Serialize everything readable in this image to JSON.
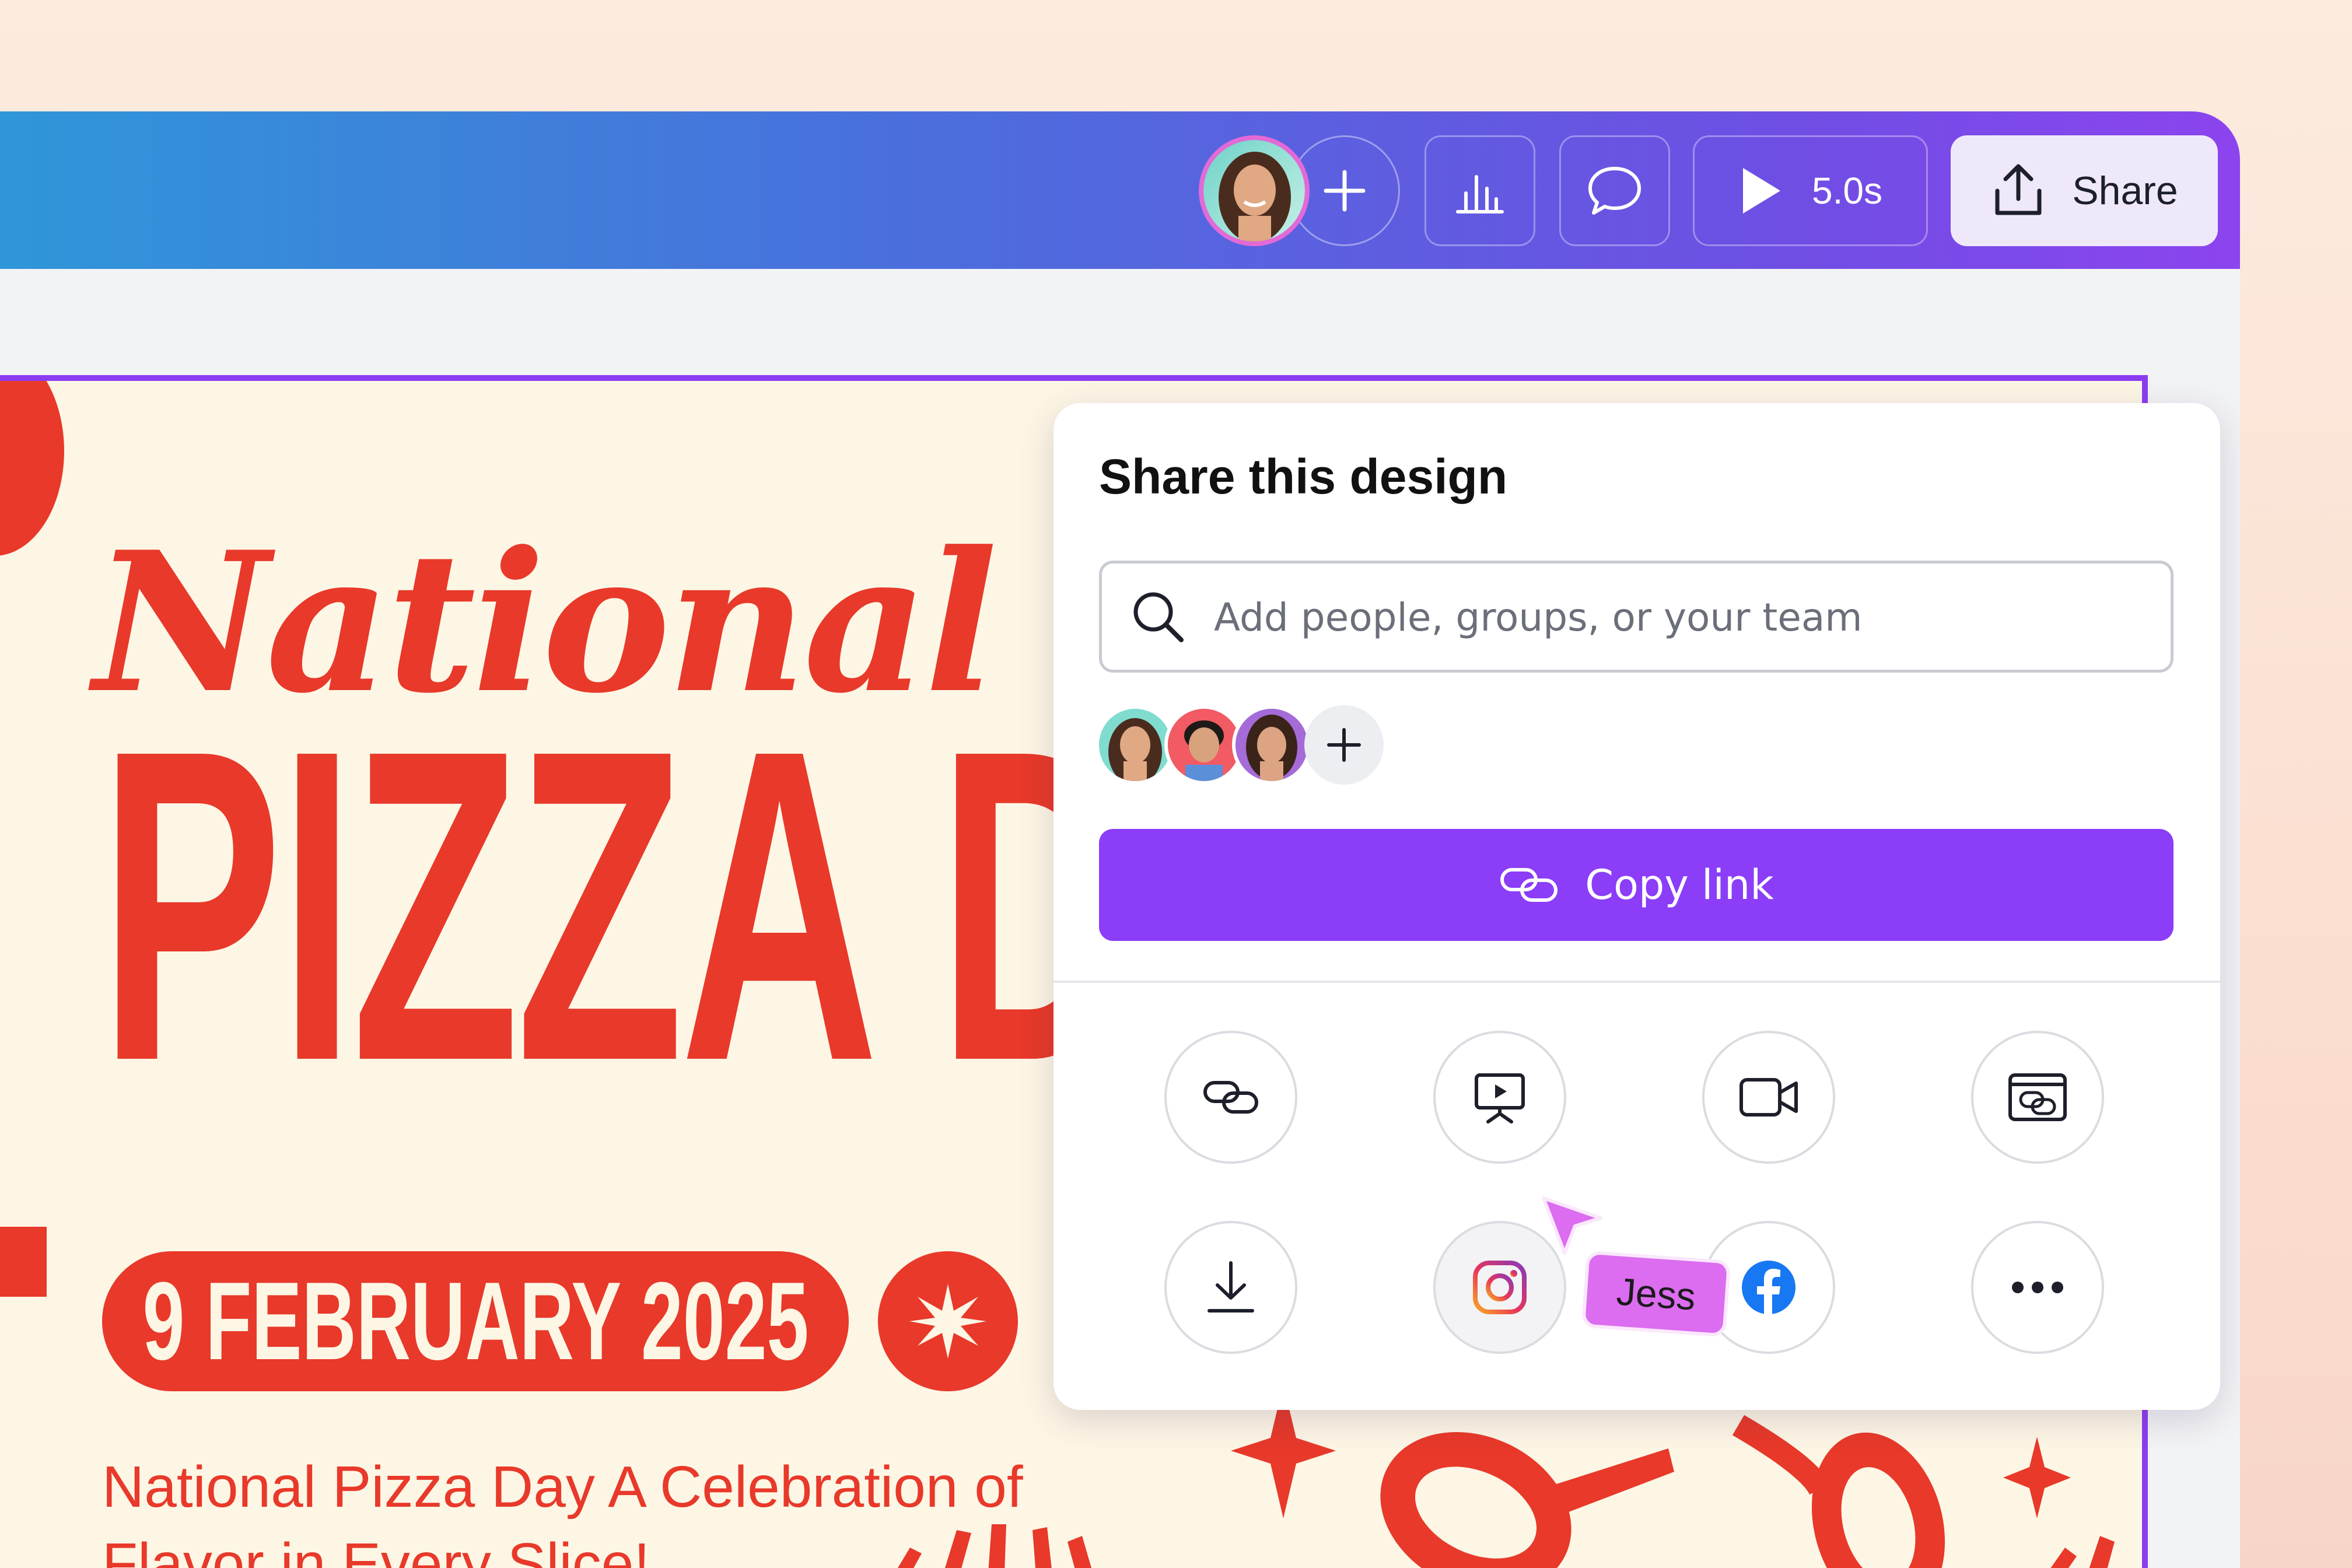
{
  "topbar": {
    "collaborator_avatar": "user-avatar",
    "add_collaborator_icon": "plus-icon",
    "insights_icon": "bar-chart-icon",
    "comment_icon": "comment-icon",
    "play_duration": "5.0s",
    "share_label": "Share",
    "gradient": [
      "#2f96d9",
      "#8c44ee"
    ]
  },
  "design": {
    "script_title": "National",
    "big_title": "PIZZA D",
    "date": "9 FEBRUARY 2025",
    "tagline_line1": "National Pizza Day A Celebration of",
    "tagline_line2": "Flavor in Every Slice!",
    "accent": "#e8392a",
    "background": "#fdf6e5"
  },
  "share_panel": {
    "title": "Share this design",
    "search_placeholder": "Add people, groups, or your team",
    "people_avatars": [
      "person-1",
      "person-2",
      "person-3"
    ],
    "copy_link_label": "Copy link",
    "copy_link_color": "#8b3df8",
    "options": [
      {
        "name": "link-icon"
      },
      {
        "name": "present-icon"
      },
      {
        "name": "video-icon"
      },
      {
        "name": "embed-icon"
      },
      {
        "name": "download-icon"
      },
      {
        "name": "instagram-icon"
      },
      {
        "name": "facebook-icon"
      },
      {
        "name": "more-icon"
      }
    ]
  },
  "cursor": {
    "user_name": "Jess",
    "color": "#dc6cf0"
  }
}
